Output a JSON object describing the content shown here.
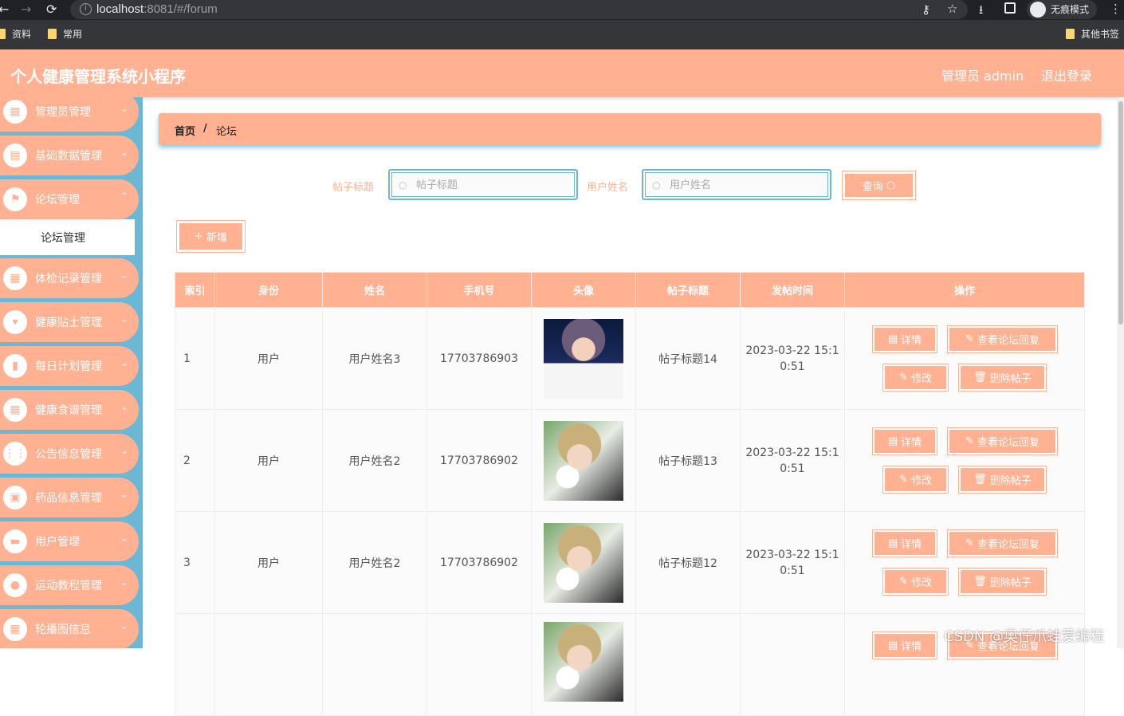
{
  "browser": {
    "url_host": "localhost",
    "url_rest": ":8081/#/forum",
    "incognito_label": "无痕模式",
    "bookmarks": [
      "资料",
      "常用"
    ],
    "other_bookmarks": "其他书签"
  },
  "header": {
    "title": "个人健康管理系统小程序",
    "admin_label": "管理员 admin",
    "logout_label": "退出登录"
  },
  "sidebar": {
    "items": [
      {
        "label": "管理员管理",
        "icon": "grid-icon"
      },
      {
        "label": "基础数据管理",
        "icon": "chat-icon"
      },
      {
        "label": "论坛管理",
        "icon": "flag-icon"
      },
      {
        "label": "体检记录管理",
        "icon": "grid-icon"
      },
      {
        "label": "健康贴士管理",
        "icon": "sign-icon"
      },
      {
        "label": "每日计划管理",
        "icon": "bar-chart-icon"
      },
      {
        "label": "健康食谱管理",
        "icon": "grid-icon"
      },
      {
        "label": "公告信息管理",
        "icon": "apps-icon"
      },
      {
        "label": "药品信息管理",
        "icon": "clipboard-icon"
      },
      {
        "label": "用户管理",
        "icon": "briefcase-icon"
      },
      {
        "label": "运动教程管理",
        "icon": "user-icon"
      },
      {
        "label": "轮播图信息",
        "icon": "grid-icon"
      }
    ],
    "sub_item": "论坛管理"
  },
  "breadcrumb": {
    "home": "首页",
    "sep": "/",
    "current": "论坛"
  },
  "search": {
    "title_label": "帖子标题",
    "title_placeholder": "帖子标题",
    "name_label": "用户姓名",
    "name_placeholder": "用户姓名",
    "query_label": "查询"
  },
  "add_label": "新增",
  "table": {
    "headers": [
      "索引",
      "身份",
      "姓名",
      "手机号",
      "头像",
      "帖子标题",
      "发帖时间",
      "操作"
    ],
    "rows": [
      {
        "idx": "1",
        "role": "用户",
        "name": "用户姓名3",
        "phone": "17703786903",
        "title": "帖子标题14",
        "time": "2023-03-22 15:1",
        "time2": "0:51"
      },
      {
        "idx": "2",
        "role": "用户",
        "name": "用户姓名2",
        "phone": "17703786902",
        "title": "帖子标题13",
        "time": "2023-03-22 15:1",
        "time2": "0:51"
      },
      {
        "idx": "3",
        "role": "用户",
        "name": "用户姓名2",
        "phone": "17703786902",
        "title": "帖子标题12",
        "time": "2023-03-22 15:1",
        "time2": "0:51"
      }
    ],
    "ops": {
      "detail": "详情",
      "reply": "查看论坛回复",
      "edit": "修改",
      "delete": "删除帖子"
    }
  },
  "watermark": "CSDN @奥仔爪蛙爱编程",
  "colors": {
    "accent": "#ffb192",
    "sidebar": "#6bb7d4"
  }
}
